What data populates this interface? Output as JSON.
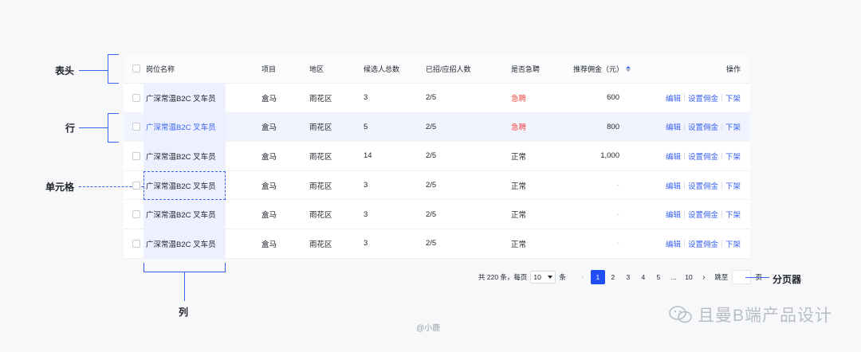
{
  "table": {
    "headers": {
      "name": "岗位名称",
      "project": "项目",
      "area": "地区",
      "candidates": "候选人总数",
      "hired": "已招/应招人数",
      "urgent": "是否急聘",
      "fee": "推荐佣金（元）",
      "ops": "操作"
    },
    "rows": [
      {
        "name": "广深常温B2C 叉车员",
        "project": "盒马",
        "area": "雨花区",
        "candidates": "3",
        "hired": "2/5",
        "urgent": "急聘",
        "fee": "600"
      },
      {
        "name": "广深常温B2C 叉车员",
        "project": "盒马",
        "area": "雨花区",
        "candidates": "5",
        "hired": "2/5",
        "urgent": "急聘",
        "fee": "800"
      },
      {
        "name": "广深常温B2C 叉车员",
        "project": "盒马",
        "area": "雨花区",
        "candidates": "14",
        "hired": "2/5",
        "urgent": "正常",
        "fee": "1,000"
      },
      {
        "name": "广深常温B2C 叉车员",
        "project": "盒马",
        "area": "雨花区",
        "candidates": "3",
        "hired": "2/5",
        "urgent": "正常",
        "fee": "-"
      },
      {
        "name": "广深常温B2C 叉车员",
        "project": "盒马",
        "area": "雨花区",
        "candidates": "3",
        "hired": "2/5",
        "urgent": "正常",
        "fee": "-"
      },
      {
        "name": "广深常温B2C 叉车员",
        "project": "盒马",
        "area": "雨花区",
        "candidates": "3",
        "hired": "2/5",
        "urgent": "正常",
        "fee": "-"
      }
    ],
    "actions": {
      "edit": "编辑",
      "set_fee": "设置佣金",
      "offline": "下架"
    }
  },
  "annotations": {
    "header": "表头",
    "row": "行",
    "cell": "单元格",
    "column": "列",
    "pagination": "分页器"
  },
  "pagination": {
    "total_prefix": "共 220 条，每页",
    "page_size": "10",
    "unit": "条",
    "pages": [
      "1",
      "2",
      "3",
      "4",
      "5",
      "...",
      "10"
    ],
    "current": "1",
    "jump_label": "跳至",
    "page_suffix": "页"
  },
  "watermark": "且曼B端产品设计",
  "credit": "@小鹿",
  "colors": {
    "accent": "#3a63f3",
    "urgent": "#f54a45",
    "active_page": "#1f4ef5"
  }
}
